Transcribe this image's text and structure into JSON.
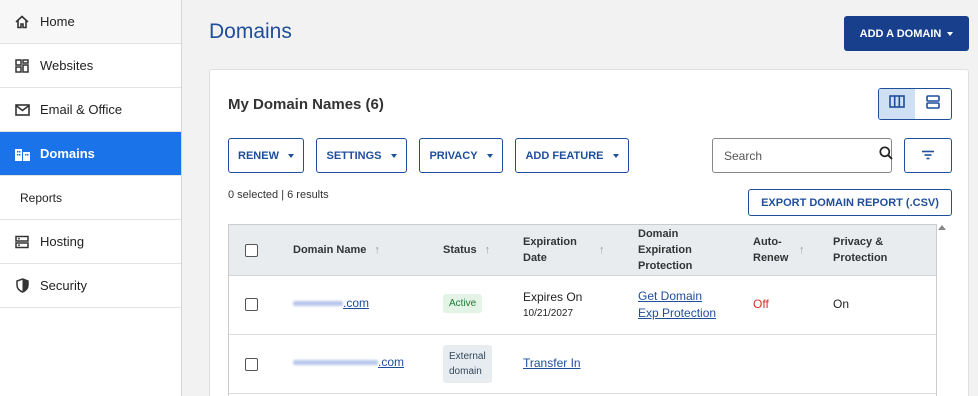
{
  "sidebar": {
    "items": [
      {
        "label": "Home",
        "icon": "home-icon"
      },
      {
        "label": "Websites",
        "icon": "websites-icon"
      },
      {
        "label": "Email & Office",
        "icon": "email-icon"
      },
      {
        "label": "Domains",
        "icon": "domains-icon",
        "active": true
      },
      {
        "label": "Reports",
        "sub": true
      },
      {
        "label": "Hosting",
        "icon": "hosting-icon"
      },
      {
        "label": "Security",
        "icon": "shield-icon"
      }
    ]
  },
  "header": {
    "title": "Domains",
    "add_domain_label": "ADD A DOMAIN"
  },
  "card": {
    "title": "My Domain Names (6)",
    "filters": {
      "renew": "RENEW",
      "settings": "SETTINGS",
      "privacy": "PRIVACY",
      "add_feature": "ADD FEATURE"
    },
    "search_placeholder": "Search",
    "results_text": "0 selected | 6 results",
    "export_label": "EXPORT DOMAIN REPORT (.CSV)"
  },
  "table": {
    "columns": {
      "domain_name": "Domain Name",
      "status": "Status",
      "expiration_date": "Expiration Date",
      "exp_protection": "Domain Expiration Protection",
      "auto_renew": "Auto-Renew",
      "privacy": "Privacy & Protection"
    },
    "rows": [
      {
        "domain_suffix": ".com",
        "status": "Active",
        "expires_label": "Expires On",
        "expires_date": "10/21/2027",
        "protection_line1": "Get Domain",
        "protection_line2": "Exp Protection",
        "auto_renew": "Off",
        "privacy": "On"
      },
      {
        "domain_suffix": ".com",
        "status_line1": "External",
        "status_line2": "domain",
        "action": "Transfer In"
      }
    ]
  },
  "colors": {
    "brand": "#183f8c",
    "active_nav": "#1a73e8",
    "off": "#d93025"
  }
}
